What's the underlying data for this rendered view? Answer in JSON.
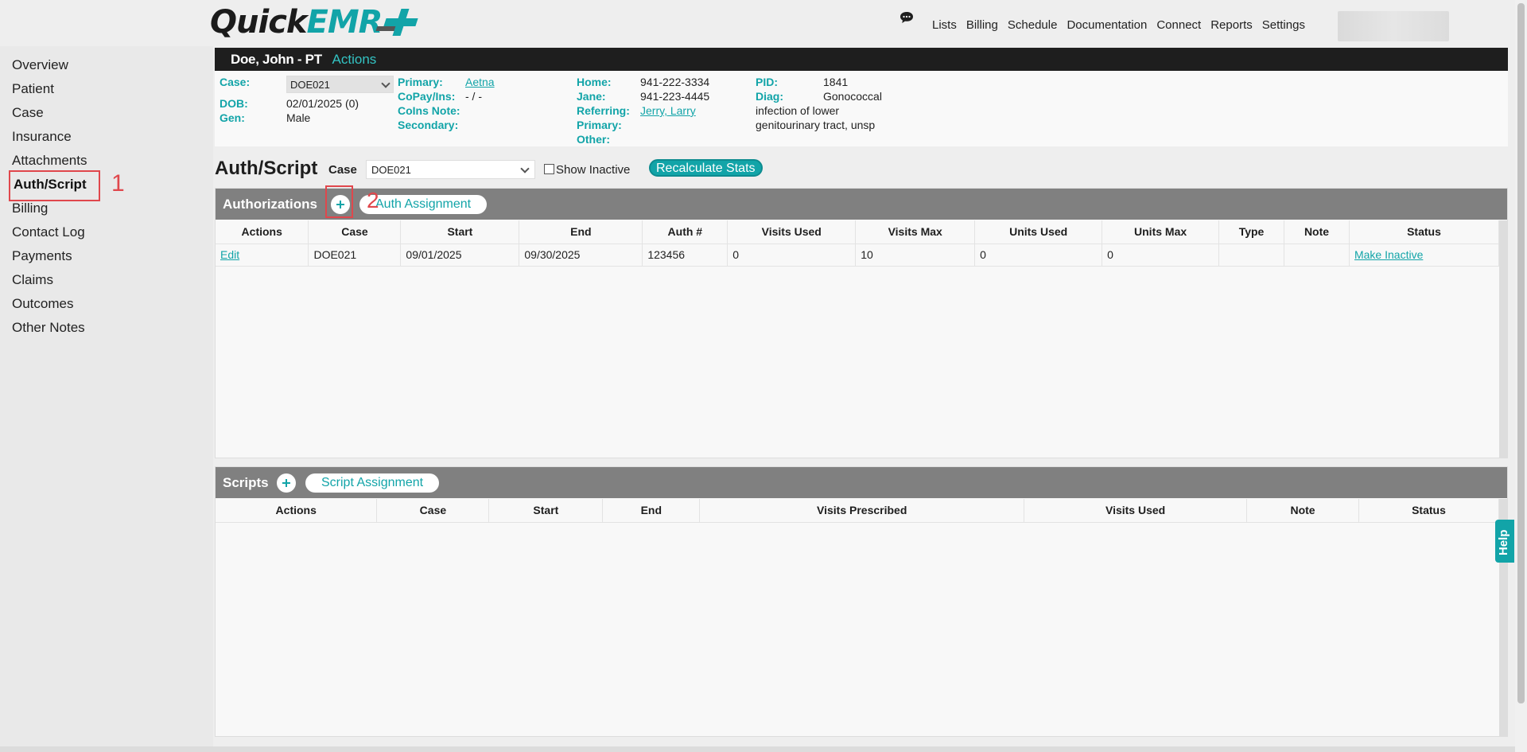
{
  "logo": {
    "quick": "Quick",
    "emr": "EMR"
  },
  "topnav": [
    "Lists",
    "Billing",
    "Schedule",
    "Documentation",
    "Connect",
    "Reports",
    "Settings"
  ],
  "sidebar": {
    "items": [
      "Overview",
      "Patient",
      "Case",
      "Insurance",
      "Attachments",
      "Auth/Script",
      "Billing",
      "Contact Log",
      "Payments",
      "Claims",
      "Outcomes",
      "Other Notes"
    ],
    "active": "Auth/Script"
  },
  "annotations": {
    "step1": "1",
    "step2": "2"
  },
  "patient": {
    "name": "Doe, John - PT",
    "actions_label": "Actions",
    "case_label": "Case:",
    "case_value": "DOE021",
    "dob_label": "DOB:",
    "dob_value": "02/01/2025 (0)",
    "gen_label": "Gen:",
    "gen_value": "Male",
    "primary_label": "Primary:",
    "primary_value": "Aetna",
    "copay_label": "CoPay/Ins:",
    "copay_value": "- / -",
    "coins_label": "CoIns Note:",
    "secondary_label": "Secondary:",
    "home_label": "Home:",
    "home_value": "941-222-3334",
    "jane_label": "Jane:",
    "jane_value": "941-223-4445",
    "referring_label": "Referring:",
    "referring_value": "Jerry, Larry",
    "primary2_label": "Primary:",
    "other_label": "Other:",
    "pid_label": "PID:",
    "pid_value": "1841",
    "diag_label": "Diag:",
    "diag_line1": "Gonococcal",
    "diag_line2": "infection of lower",
    "diag_line3": "genitourinary tract, unsp"
  },
  "auth_script": {
    "title": "Auth/Script",
    "case_label": "Case",
    "case_value": "DOE021",
    "show_inactive_label": "Show Inactive",
    "recalc_label": "Recalculate Stats"
  },
  "authorizations": {
    "title": "Authorizations",
    "assignment_label": "Auth Assignment",
    "columns": [
      "Actions",
      "Case",
      "Start",
      "End",
      "Auth #",
      "Visits Used",
      "Visits Max",
      "Units Used",
      "Units Max",
      "Type",
      "Note",
      "Status"
    ],
    "rows": [
      {
        "action": "Edit",
        "case": "DOE021",
        "start": "09/01/2025",
        "end": "09/30/2025",
        "auth_no": "123456",
        "visits_used": "0",
        "visits_max": "10",
        "units_used": "0",
        "units_max": "0",
        "type": "",
        "note": "",
        "status": "Make Inactive"
      }
    ]
  },
  "scripts": {
    "title": "Scripts",
    "assignment_label": "Script Assignment",
    "columns": [
      "Actions",
      "Case",
      "Start",
      "End",
      "Visits Prescribed",
      "Visits Used",
      "Note",
      "Status"
    ]
  },
  "help_label": "Help",
  "colors": {
    "accent": "#12a4a8",
    "header_bg": "#1e1e1e",
    "panel_bar": "#808080",
    "annotation": "#e0474c"
  },
  "icons": {
    "chat": "chat-bubble-icon",
    "plus": "plus-circle-icon",
    "dropdown": "chevron-down-icon"
  }
}
